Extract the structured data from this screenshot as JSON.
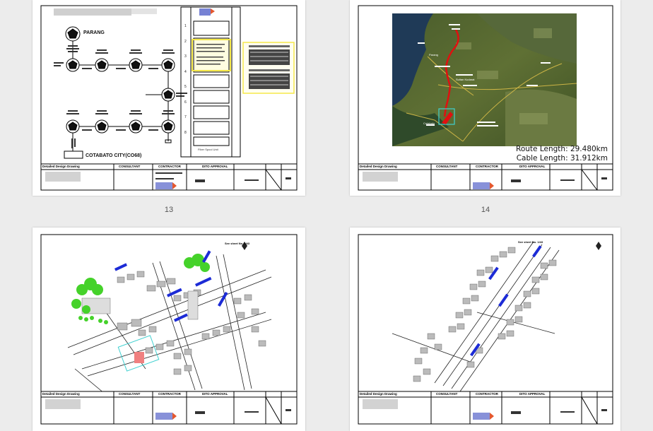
{
  "pages": [
    {
      "number_label": "13",
      "diagram": {
        "label_top": "PARANG",
        "label_bottom": "COTABATO CITY(CO68)",
        "table_footer": "Fiber Spool Unit",
        "numbers": [
          "1",
          "2",
          "3",
          "4",
          "5",
          "6",
          "7",
          "8"
        ]
      }
    },
    {
      "number_label": "14",
      "map": {
        "route_length": "Route Length: 29.480km",
        "cable_length": "Cable Length: 31.912km",
        "places": [
          "Parang",
          "Cotabato",
          "Sultan Kudarat"
        ]
      }
    },
    {
      "number_label": "",
      "sheet_ref": "See sheet No. 1/43"
    },
    {
      "number_label": "",
      "sheet_ref": "See sheet No. 1/43"
    }
  ],
  "titleblock": {
    "detailed_design": "Detailed Design Drawing",
    "contractor": "CONTRACTOR",
    "consultant": "CONSULTANT",
    "approval": "DITO APPROVAL"
  },
  "colors": {
    "page_bg": "#ffffff",
    "viewer_bg": "#ececec",
    "route_red": "#e01010",
    "highlight_yellow": "#f5e84a",
    "annotation_blue": "#1c2bd6",
    "tree_green": "#45d22a",
    "logo_blue": "#5563c9",
    "logo_orange": "#e4572e"
  }
}
